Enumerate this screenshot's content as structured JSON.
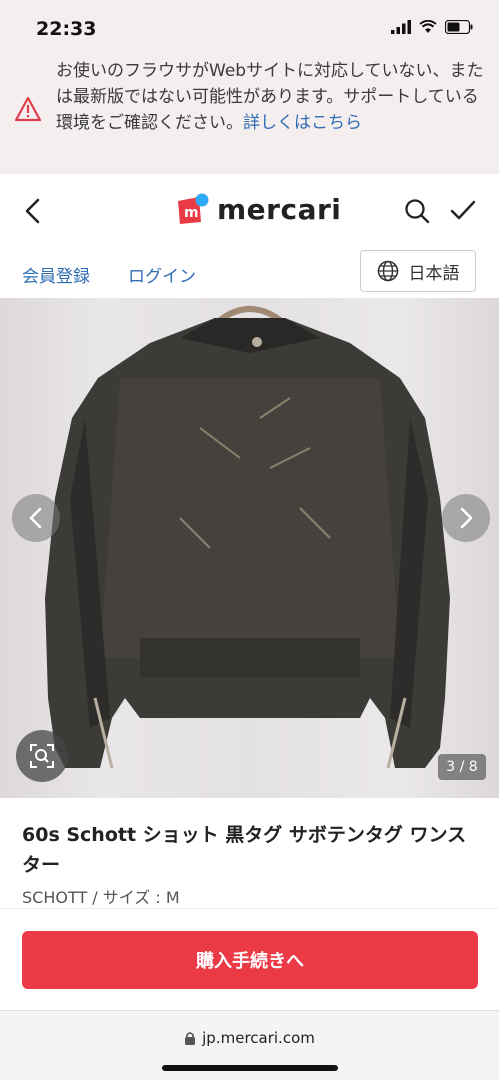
{
  "status_bar": {
    "time": "22:33"
  },
  "warning": {
    "text": "お使いのフラウサがWebサイトに対応していない、または最新版ではない可能性があります。サポートしている環境をご確認ください。",
    "link_text": "詳しくはこちら"
  },
  "header": {
    "logo_text": "mercari",
    "logo_mark": "m"
  },
  "nav": {
    "register": "会員登録",
    "login": "ログイン",
    "language": "日本語"
  },
  "carousel": {
    "counter": "3 / 8"
  },
  "item": {
    "title": "60s Schott ショット 黒タグ サボテンタグ ワンスター",
    "subtitle": "SCHOTT / サイズ : M"
  },
  "purchase": {
    "button_label": "購入手続きへ"
  },
  "browser": {
    "url": "jp.mercari.com"
  },
  "colors": {
    "accent_red": "#ea3a46",
    "link_blue": "#2f6db5",
    "warning_bg": "#f5eeee"
  }
}
